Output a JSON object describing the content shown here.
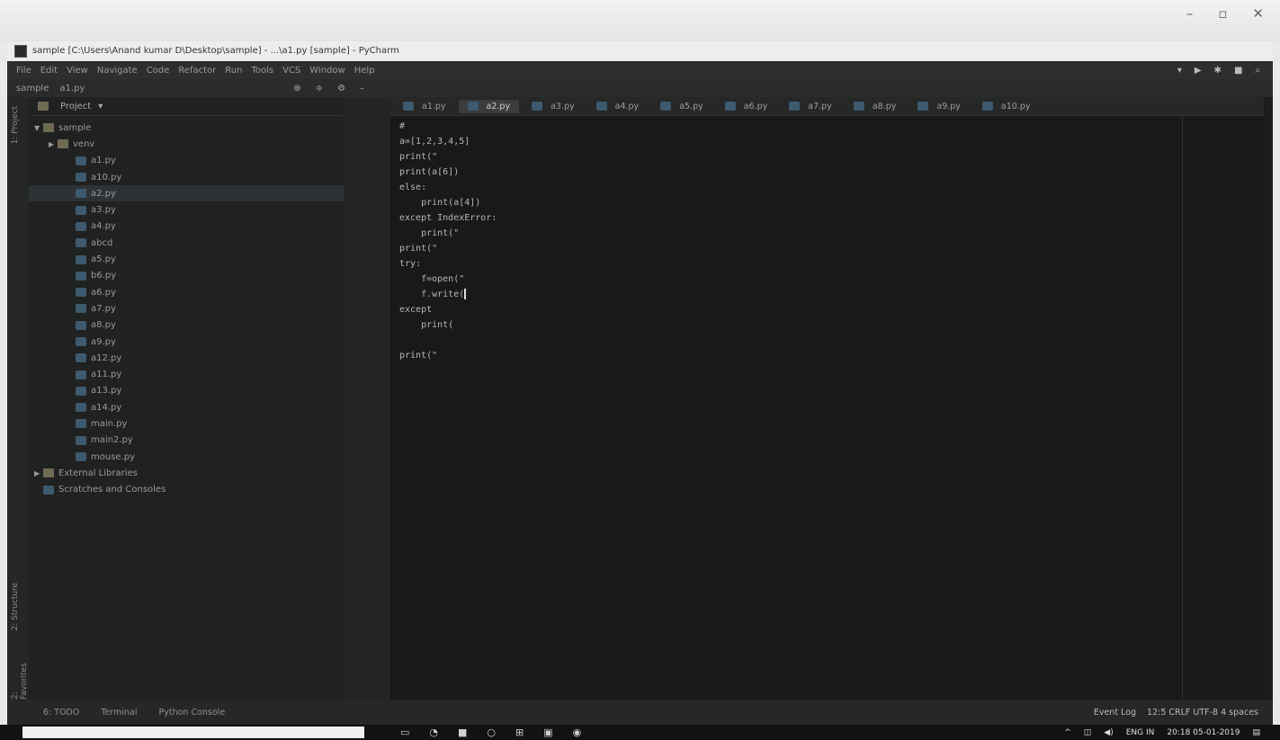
{
  "window": {
    "title": "sample [C:\\Users\\Anand kumar D\\Desktop\\sample] - ...\\a1.py [sample] - PyCharm",
    "controls": [
      "–",
      "▫",
      "✕"
    ]
  },
  "menu": [
    "File",
    "Edit",
    "View",
    "Navigate",
    "Code",
    "Refactor",
    "Run",
    "Tools",
    "VCS",
    "Window",
    "Help"
  ],
  "breadcrumb": [
    "sample",
    "a1.py"
  ],
  "project_panel": {
    "header": "Project",
    "root": "sample",
    "venv": "venv",
    "files": [
      "a1.py",
      "a10.py",
      "a2.py",
      "a3.py",
      "a4.py",
      "abcd",
      "a5.py",
      "b6.py",
      "a6.py",
      "a7.py",
      "a8.py",
      "a9.py",
      "a12.py",
      "a11.py",
      "a13.py",
      "a14.py",
      "main.py",
      "main2.py",
      "mouse.py"
    ],
    "selected_index": 2,
    "external_libraries": "External Libraries",
    "scratches": "Scratches and Consoles"
  },
  "left_strip": {
    "project_label": "1: Project",
    "structure_label": "2: Structure",
    "favorites_label": "2: Favorites"
  },
  "tabs": [
    "a1.py",
    "a2.py",
    "a3.py",
    "a4.py",
    "a5.py",
    "a6.py",
    "a7.py",
    "a8.py",
    "a9.py",
    "a10.py"
  ],
  "active_tab_index": 1,
  "code_lines": [
    "#",
    "a=[1,2,3,4,5]",
    "print(\"",
    "print(a[6])",
    "else:",
    "    print(a[4])",
    "except IndexError:",
    "    print(\"",
    "print(\"",
    "try:",
    "    f=open(\"",
    "    f.write(",
    "except",
    "    print(",
    "",
    "print(\""
  ],
  "statusbar": {
    "items": [
      "6: TODO",
      "Terminal",
      "Python Console"
    ],
    "event_log": "Event Log",
    "position": "12:5  CRLF  UTF-8  4 spaces"
  },
  "taskbar": {
    "clock_time": "20:18",
    "clock_date": "05-01-2019",
    "lang": "ENG IN"
  }
}
